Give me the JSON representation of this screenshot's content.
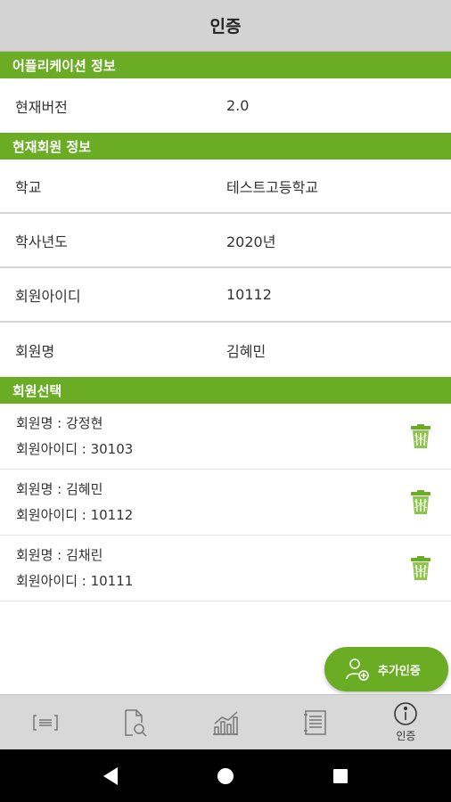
{
  "header": {
    "title": "인증"
  },
  "app_info": {
    "section_title": "어플리케이션 정보",
    "rows": [
      {
        "label": "현재버전",
        "value": "2.0"
      }
    ]
  },
  "member_info": {
    "section_title": "현재회원 정보",
    "rows": [
      {
        "label": "학교",
        "value": "테스트고등학교"
      },
      {
        "label": "학사년도",
        "value": "2020년"
      },
      {
        "label": "회원아이디",
        "value": "10112"
      },
      {
        "label": "회원명",
        "value": "김혜민"
      }
    ]
  },
  "member_select": {
    "section_title": "회원선택",
    "items": [
      {
        "name_line": "회원명 : 강정현",
        "id_line": "회원아이디 : 30103"
      },
      {
        "name_line": "회원명 : 김혜민",
        "id_line": "회원아이디 : 10112"
      },
      {
        "name_line": "회원명 : 김채린",
        "id_line": "회원아이디 : 10111"
      }
    ]
  },
  "fab": {
    "label": "추가인증",
    "icon": "add-user-icon"
  },
  "bottom_nav": {
    "items": [
      {
        "icon": "notice-board-icon",
        "label": ""
      },
      {
        "icon": "document-search-icon",
        "label": ""
      },
      {
        "icon": "bar-chart-icon",
        "label": ""
      },
      {
        "icon": "list-document-icon",
        "label": ""
      },
      {
        "icon": "info-icon",
        "label": "인증"
      }
    ],
    "active_index": 4
  },
  "colors": {
    "accent": "#6aac24",
    "header_bg": "#d3d3d3",
    "nav_bg": "#d8d8d8"
  }
}
